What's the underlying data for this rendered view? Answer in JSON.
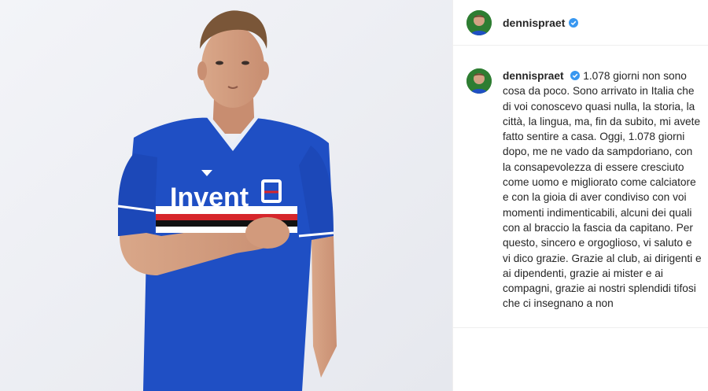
{
  "post": {
    "image_alt": "Player in blue Sampdoria jersey holding captain armband",
    "jersey_sponsor": "Invent"
  },
  "header": {
    "username": "dennispraet",
    "verified": true
  },
  "caption": {
    "username": "dennispraet",
    "text": "1.078 giorni non sono cosa da poco. Sono arrivato in Italia che di voi conoscevo quasi nulla, la storia, la città, la lingua, ma, fin da subito, mi avete fatto sentire a casa. Oggi, 1.078 giorni dopo, me ne vado da sampdoriano, con la consapevolezza di essere cresciuto come uomo e migliorato come calciatore e con la gioia di aver condiviso con voi momenti indimenticabili, alcuni dei quali con al braccio la fascia da capitano. Per questo, sincero e orgoglioso, vi saluto e vi dico grazie. Grazie al club, ai dirigenti e ai dipendenti, grazie ai mister e ai compagni, grazie ai nostri splendidi tifosi che ci insegnano a non"
  },
  "colors": {
    "verified_blue": "#3897f0",
    "jersey_blue": "#1f4fc4",
    "text": "#262626"
  }
}
